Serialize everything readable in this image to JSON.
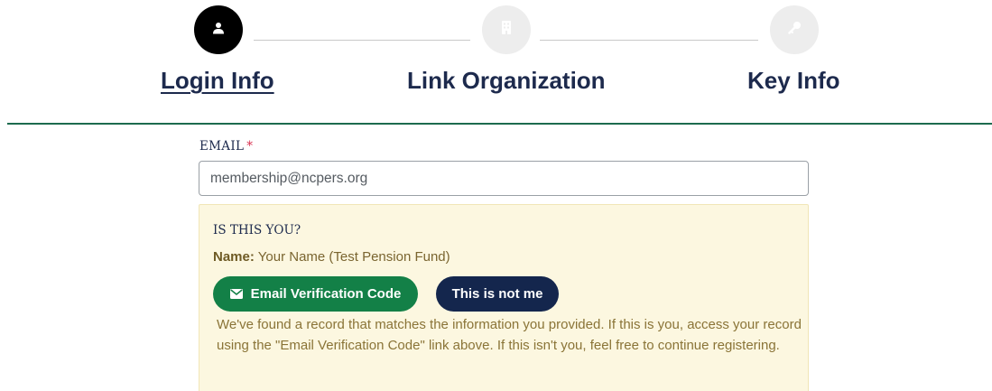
{
  "stepper": {
    "steps": [
      {
        "label": "Login Info",
        "icon": "user-icon",
        "state": "active"
      },
      {
        "label": "Link Organization",
        "icon": "building-icon",
        "state": "inactive"
      },
      {
        "label": "Key Info",
        "icon": "key-icon",
        "state": "inactive"
      }
    ]
  },
  "form": {
    "email_label": "EMAIL",
    "required_marker": "*",
    "email_value": "membership@ncpers.org"
  },
  "match_panel": {
    "title": "IS THIS YOU?",
    "name_label": "Name:",
    "name_value": " Your Name (Test Pension Fund)",
    "email_code_button": "Email Verification Code",
    "email_code_icon": "envelope-icon",
    "not_me_button": "This is not me",
    "message": "We've found a record that matches the information you provided. If this is you, access your record using the \"Email Verification Code\" link above. If this isn't you, feel free to continue registering."
  },
  "colors": {
    "primary_navy": "#14264d",
    "success_green": "#138047",
    "divider_green": "#1d6b4f",
    "panel_bg": "#fcf7e0",
    "required_red": "#d9304f"
  }
}
